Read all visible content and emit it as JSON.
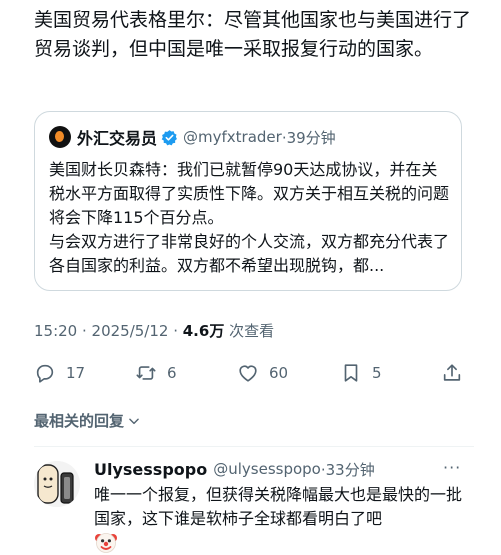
{
  "tweet": {
    "text": "美国贸易代表格里尔：尽管其他国家也与美国进行了贸易谈判，但中国是唯一采取报复行动的国家。"
  },
  "quote": {
    "name": "外汇交易员",
    "handle": "@myfxtrader",
    "time": "·39分钟",
    "body_1": "美国财长贝森特：我们已就暂停90天达成协议，并在关税水平方面取得了实质性下降。双方关于相互关税的问题将会下降115个百分点。",
    "body_2": "与会双方进行了非常良好的个人交流，双方都充分代表了各自国家的利益。双方都不希望出现脱钩，都..."
  },
  "meta": {
    "time_date": "15:20 · 2025/5/12 · ",
    "views": "4.6万",
    "views_label": " 次查看"
  },
  "actions": {
    "replies": "17",
    "retweets": "6",
    "likes": "60",
    "bookmarks": "5"
  },
  "sort": {
    "label": "最相关的回复"
  },
  "reply": {
    "name": "Ulysesspopo",
    "handle": "@ulysesspopo",
    "time": "·33分钟",
    "more": "···",
    "body": "唯一一个报复，但获得关税降幅最大也是最快的一批国家，这下谁是软柿子全球都看明白了吧",
    "emoji": "clown-face-emoji"
  },
  "colors": {
    "secondary_text": "#536471",
    "border": "#cfd9de",
    "verified": "#1d9bf0"
  }
}
